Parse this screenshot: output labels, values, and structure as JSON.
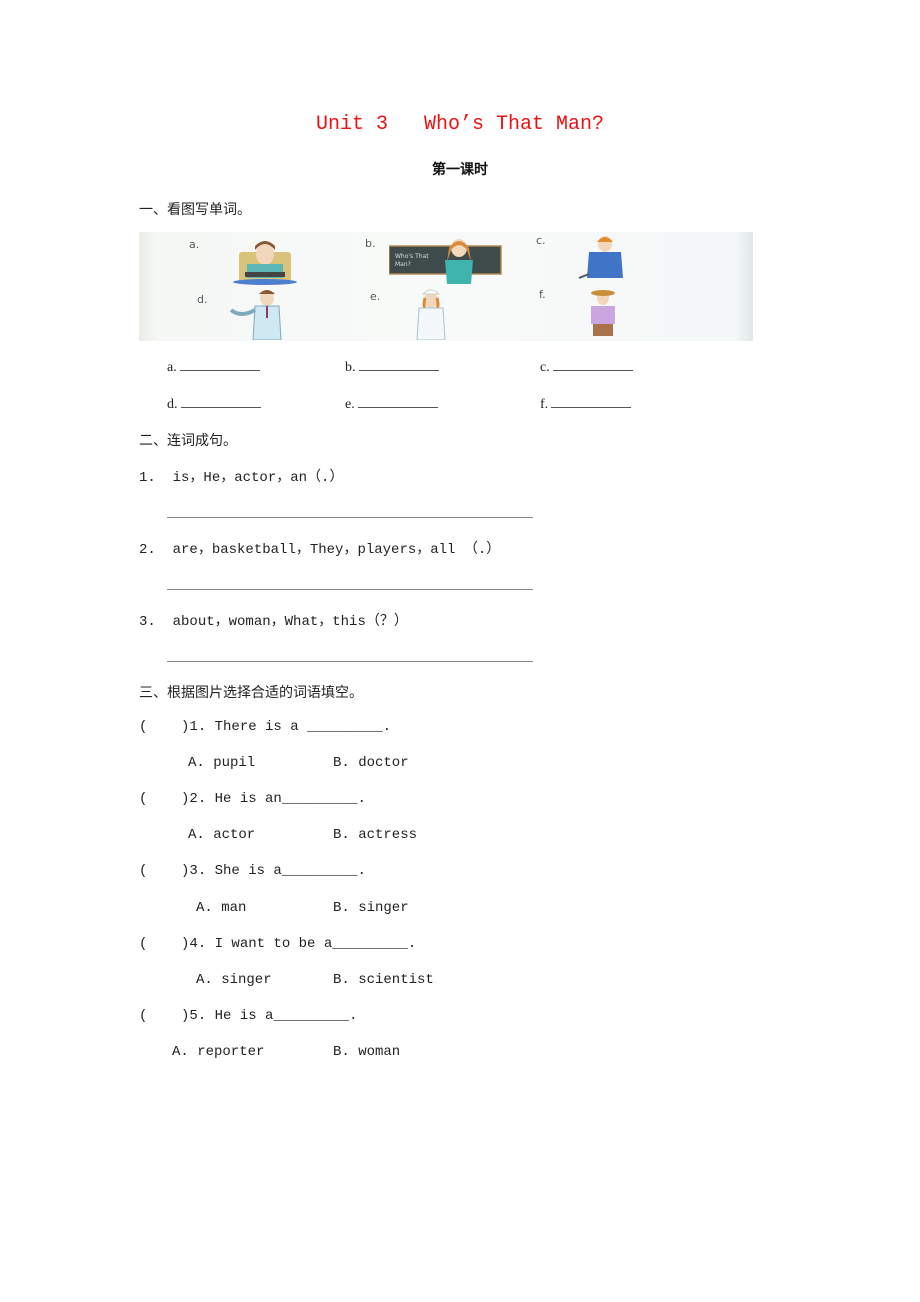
{
  "title": "Unit 3   Who’s That Man?",
  "subtitle": "第一课时",
  "section1": {
    "heading": "一、看图写单词。",
    "picture": {
      "labels": [
        "a.",
        "b.",
        "c.",
        "d.",
        "e.",
        "f."
      ],
      "figures": [
        "driver-at-wheel",
        "teacher-at-blackboard",
        "worker-with-helmet",
        "doctor-with-stethoscope",
        "nurse",
        "farmer-with-hat"
      ],
      "blackboard_text": "Who's That Man?"
    },
    "blanks": [
      "a.",
      "b.",
      "c.",
      "d.",
      "e.",
      "f."
    ]
  },
  "section2": {
    "heading": "二、连词成句。",
    "items": [
      {
        "num": "1.",
        "text": "is，He，actor，an（.）"
      },
      {
        "num": "2.",
        "text": "are，basketball，They，players，all （.）"
      },
      {
        "num": "3.",
        "text": "about，woman，What，this（？）"
      }
    ]
  },
  "section3": {
    "heading": "三、根据图片选择合适的词语填空。",
    "questions": [
      {
        "bracket": "(    )",
        "stem": "1. There is a ",
        "blank": "_________",
        "end": ".",
        "optA": "A. pupil",
        "optB": "B. doctor"
      },
      {
        "bracket": "(    )",
        "stem": "2. He is an",
        "blank": "_________",
        "end": ".",
        "optA": "A. actor",
        "optB": "B. actress"
      },
      {
        "bracket": "(    )",
        "stem": "3. She is a",
        "blank": "_________",
        "end": ".",
        "optA": "A. man",
        "optB": "B. singer"
      },
      {
        "bracket": "(    )",
        "stem": "4. I want to be a",
        "blank": "_________",
        "end": ".",
        "optA": "A. singer",
        "optB": "B. scientist"
      },
      {
        "bracket": "(    )",
        "stem": "5. He is a",
        "blank": "_________",
        "end": ".",
        "optA": "A. reporter",
        "optB": "B. woman"
      }
    ]
  }
}
